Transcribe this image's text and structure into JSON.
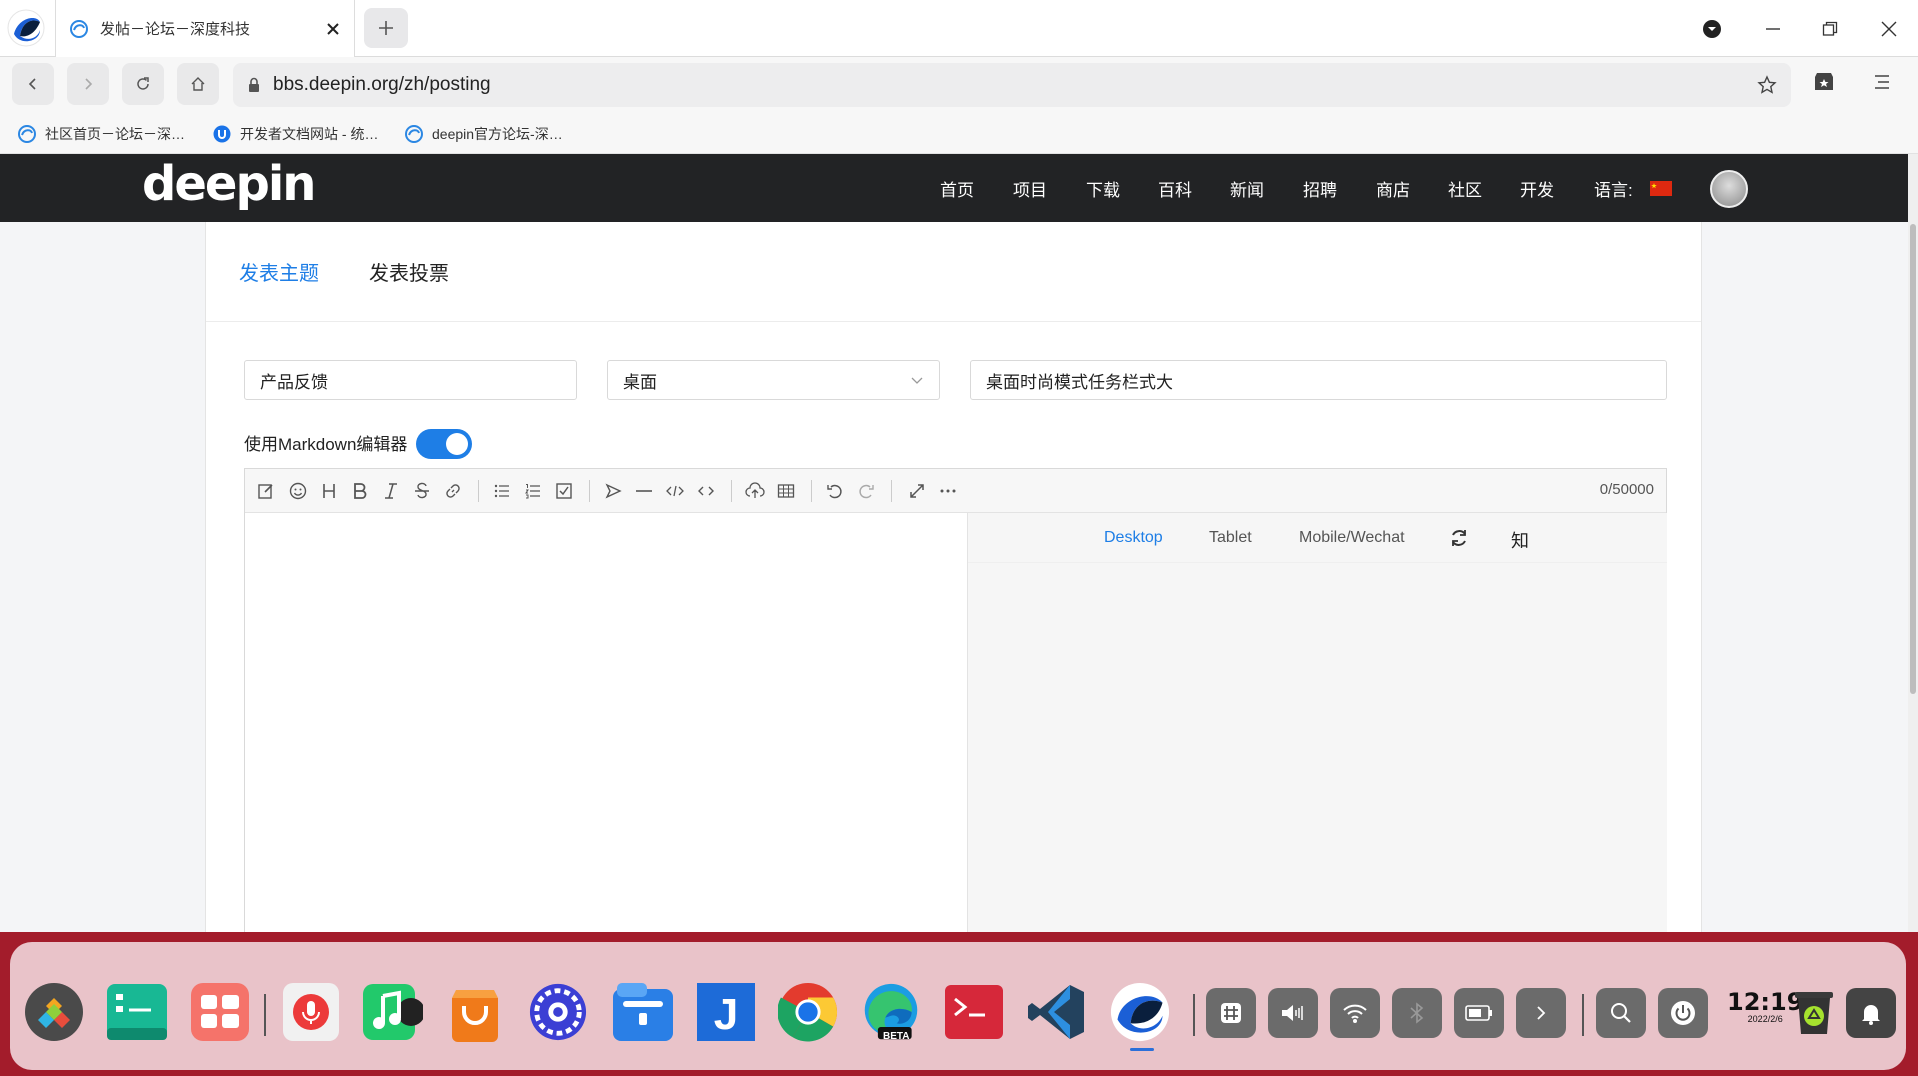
{
  "browser": {
    "tab_title": "发帖－论坛－深度科技",
    "url": "bbs.deepin.org/zh/posting",
    "bookmarks": [
      {
        "label": "社区首页－论坛－深…",
        "icon": "deepin-forum-icon"
      },
      {
        "label": "开发者文档网站 - 统…",
        "icon": "uos-dev-icon"
      },
      {
        "label": "deepin官方论坛-深…",
        "icon": "deepin-forum-icon"
      }
    ]
  },
  "site": {
    "logo": "deepin",
    "nav": [
      "首页",
      "项目",
      "下载",
      "百科",
      "新闻",
      "招聘",
      "商店",
      "社区",
      "开发"
    ],
    "language_label": "语言:",
    "accent": "#1e7ee6"
  },
  "post": {
    "tabs": [
      "发表主题",
      "发表投票"
    ],
    "category": "产品反馈",
    "subcategory": "桌面",
    "title": "桌面时尚模式任务栏式大",
    "markdown_label": "使用Markdown编辑器",
    "markdown_enabled": true,
    "counter": "0/50000",
    "preview_modes": [
      "Desktop",
      "Tablet",
      "Mobile/Wechat"
    ],
    "preview_extra": "知"
  },
  "dock": {
    "apps": [
      "launcher-icon",
      "deepin-terminal-icon",
      "multitask-view-icon",
      "voice-note-icon",
      "music-icon",
      "app-store-icon",
      "control-center-icon",
      "file-manager-icon",
      "jetbrains-icon",
      "chrome-icon",
      "edge-beta-icon",
      "terminal-red-icon",
      "vscode-icon",
      "browser-icon"
    ],
    "edge_badge": "BETA",
    "time": "12:19",
    "date": "2022/2/6"
  }
}
